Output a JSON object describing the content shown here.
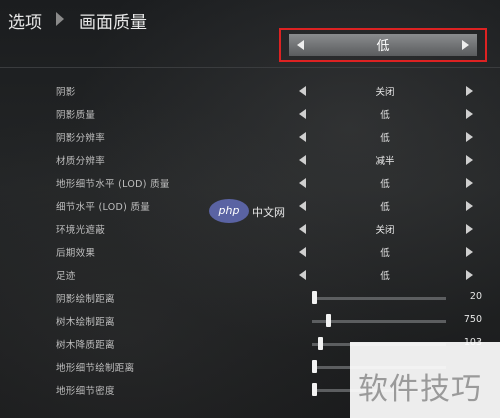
{
  "breadcrumb": {
    "parent": "选项",
    "current": "画面质量"
  },
  "preset": {
    "value": "低"
  },
  "options": [
    {
      "label": "阴影",
      "value": "关闭"
    },
    {
      "label": "阴影质量",
      "value": "低"
    },
    {
      "label": "阴影分辨率",
      "value": "低"
    },
    {
      "label": "材质分辨率",
      "value": "减半"
    },
    {
      "label": "地形细节水平 (LOD) 质量",
      "value": "低"
    },
    {
      "label": "细节水平 (LOD) 质量",
      "value": "低"
    },
    {
      "label": "环境光遮蔽",
      "value": "关闭"
    },
    {
      "label": "后期效果",
      "value": "低"
    },
    {
      "label": "足迹",
      "value": "低"
    }
  ],
  "sliders": [
    {
      "label": "阴影绘制距离",
      "value": "20",
      "level": 0.0
    },
    {
      "label": "树木绘制距离",
      "value": "750",
      "level": 0.11
    },
    {
      "label": "树木降质距离",
      "value": "103",
      "level": 0.05
    },
    {
      "label": "地形细节绘制距离",
      "value": "",
      "level": 0.0
    },
    {
      "label": "地形细节密度",
      "value": "",
      "level": 0.0
    }
  ],
  "watermarks": {
    "php_logo": "php",
    "php_cn": "中文网",
    "corner": "软件技巧"
  }
}
